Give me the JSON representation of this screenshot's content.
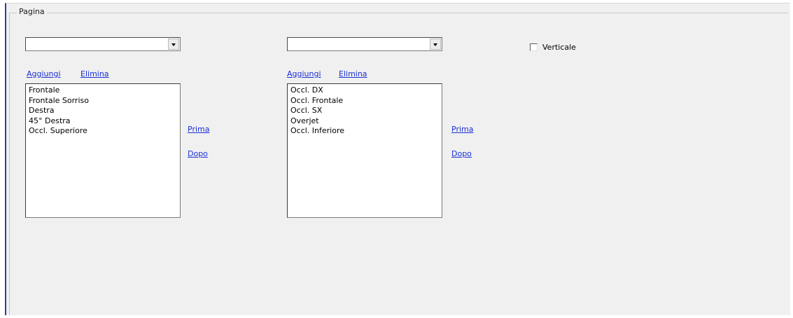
{
  "group": {
    "title": "Pagina"
  },
  "left_panel": {
    "combo_value": "",
    "add_label": "Aggiungi",
    "delete_label": "Elimina",
    "items": [
      "Frontale",
      "Frontale Sorriso",
      "Destra",
      "45° Destra",
      "Occl. Superiore"
    ],
    "before_label": "Prima",
    "after_label": "Dopo"
  },
  "right_panel": {
    "combo_value": "",
    "add_label": "Aggiungi",
    "delete_label": "Elimina",
    "items": [
      "Occl. DX",
      "Occl. Frontale",
      "Occl. SX",
      "Overjet",
      "Occl. Inferiore"
    ],
    "before_label": "Prima",
    "after_label": "Dopo"
  },
  "vertical_checkbox": {
    "label": "Verticale",
    "checked": false
  }
}
